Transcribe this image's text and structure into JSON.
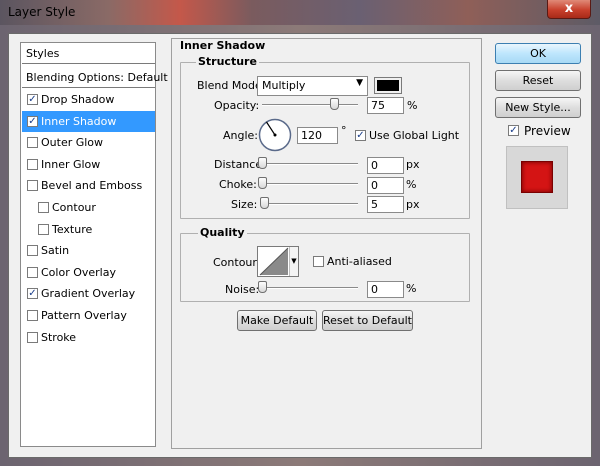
{
  "window": {
    "title": "Layer Style",
    "close_glyph": "x"
  },
  "styles_list": {
    "header": "Styles",
    "blending": "Blending Options: Default",
    "items": [
      {
        "label": "Drop Shadow",
        "checked": true
      },
      {
        "label": "Inner Shadow",
        "checked": true,
        "selected": true
      },
      {
        "label": "Outer Glow",
        "checked": false
      },
      {
        "label": "Inner Glow",
        "checked": false
      },
      {
        "label": "Bevel and Emboss",
        "checked": false
      },
      {
        "label": "Contour",
        "checked": false,
        "indent": true
      },
      {
        "label": "Texture",
        "checked": false,
        "indent": true
      },
      {
        "label": "Satin",
        "checked": false
      },
      {
        "label": "Color Overlay",
        "checked": false
      },
      {
        "label": "Gradient Overlay",
        "checked": true
      },
      {
        "label": "Pattern Overlay",
        "checked": false
      },
      {
        "label": "Stroke",
        "checked": false
      }
    ]
  },
  "inner_shadow": {
    "section_title": "Inner Shadow",
    "structure": {
      "title": "Structure",
      "blend_mode": {
        "label": "Blend Mode:",
        "value": "Multiply",
        "color": "#000000"
      },
      "opacity": {
        "label": "Opacity:",
        "value": "75",
        "unit": "%",
        "slider_fraction": 0.75
      },
      "angle": {
        "label": "Angle:",
        "value": "120",
        "unit": "°",
        "use_global_light": true,
        "use_global_light_label": "Use Global Light"
      },
      "distance": {
        "label": "Distance:",
        "value": "0",
        "unit": "px",
        "slider_fraction": 0.0
      },
      "choke": {
        "label": "Choke:",
        "value": "0",
        "unit": "%",
        "slider_fraction": 0.0
      },
      "size": {
        "label": "Size:",
        "value": "5",
        "unit": "px",
        "slider_fraction": 0.02
      }
    },
    "quality": {
      "title": "Quality",
      "contour_label": "Contour:",
      "anti_aliased": false,
      "anti_aliased_label": "Anti-aliased",
      "noise": {
        "label": "Noise:",
        "value": "0",
        "unit": "%",
        "slider_fraction": 0.0
      }
    },
    "make_default": "Make Default",
    "reset_to_default": "Reset to Default"
  },
  "actions": {
    "ok": "OK",
    "reset": "Reset",
    "new_style": "New Style...",
    "preview_label": "Preview",
    "preview_checked": true,
    "preview_color": "#d41414"
  },
  "icons": [
    "close-icon",
    "checkbox-icon",
    "dropdown-arrow-icon",
    "angle-dial-icon",
    "contour-curve-icon",
    "slider-thumb-icon"
  ]
}
